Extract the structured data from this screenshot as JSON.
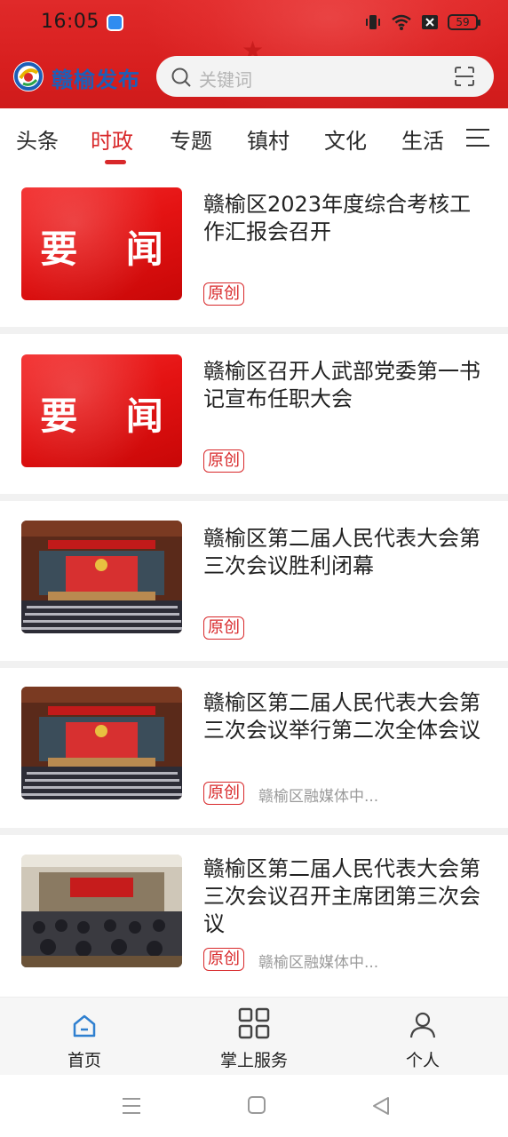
{
  "status_bar": {
    "time": "16:05",
    "battery": "59"
  },
  "header": {
    "brand": "赣榆发布",
    "search_placeholder": "关键词"
  },
  "tabs": [
    {
      "label": "头条"
    },
    {
      "label": "时政"
    },
    {
      "label": "专题"
    },
    {
      "label": "镇村"
    },
    {
      "label": "文化"
    },
    {
      "label": "生活"
    }
  ],
  "active_tab": "时政",
  "news": [
    {
      "title": "赣榆区2023年度综合考核工作汇报会召开",
      "badge": "原创",
      "source": "",
      "thumb_text": "要 闻"
    },
    {
      "title": "赣榆区召开人武部党委第一书记宣布任职大会",
      "badge": "原创",
      "source": "",
      "thumb_text": "要 闻"
    },
    {
      "title": "赣榆区第二届人民代表大会第三次会议胜利闭幕",
      "badge": "原创",
      "source": ""
    },
    {
      "title": "赣榆区第二届人民代表大会第三次会议举行第二次全体会议",
      "badge": "原创",
      "source": "赣榆区融媒体中..."
    },
    {
      "title": "赣榆区第二届人民代表大会第三次会议召开主席团第三次会议",
      "badge": "原创",
      "source": "赣榆区融媒体中..."
    }
  ],
  "bottom_nav": [
    {
      "label": "首页"
    },
    {
      "label": "掌上服务"
    },
    {
      "label": "个人"
    }
  ],
  "colors": {
    "brand_red": "#d8282a",
    "header_red": "#dc2424",
    "brand_blue": "#1d5fb8",
    "nav_active": "#2f80d0"
  }
}
